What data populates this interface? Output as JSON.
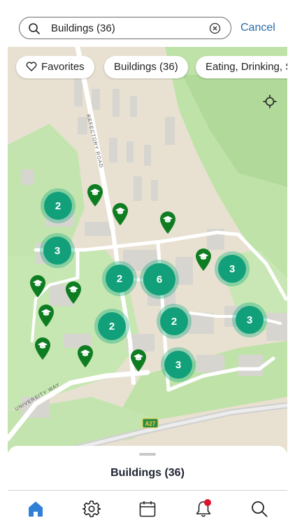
{
  "search": {
    "value": "Buildings (36)",
    "cancel_label": "Cancel"
  },
  "filters": [
    {
      "label": "Favorites",
      "icon": "heart-icon"
    },
    {
      "label": "Buildings (36)"
    },
    {
      "label": "Eating, Drinking, S"
    }
  ],
  "map": {
    "road_labels": [
      "REFECTORY ROAD",
      "UNIVERSITY WAY",
      "A27"
    ],
    "clusters": [
      "2",
      "3",
      "2",
      "6",
      "3",
      "2",
      "2",
      "3",
      "3"
    ],
    "building_pin_count": 11,
    "colors": {
      "cluster": "#12a07a",
      "pin": "#0e7d22",
      "grass": "#b9dfa4",
      "road": "#ffffff"
    }
  },
  "sheet": {
    "title": "Buildings (36)"
  },
  "tabs": [
    {
      "name": "home-icon",
      "active": true
    },
    {
      "name": "gear-icon"
    },
    {
      "name": "calendar-icon"
    },
    {
      "name": "bell-icon",
      "badge": true
    },
    {
      "name": "search-icon"
    }
  ],
  "colors": {
    "accent": "#2a6aa8",
    "tab_active": "#2f7fd8",
    "badge": "#e0122d"
  }
}
